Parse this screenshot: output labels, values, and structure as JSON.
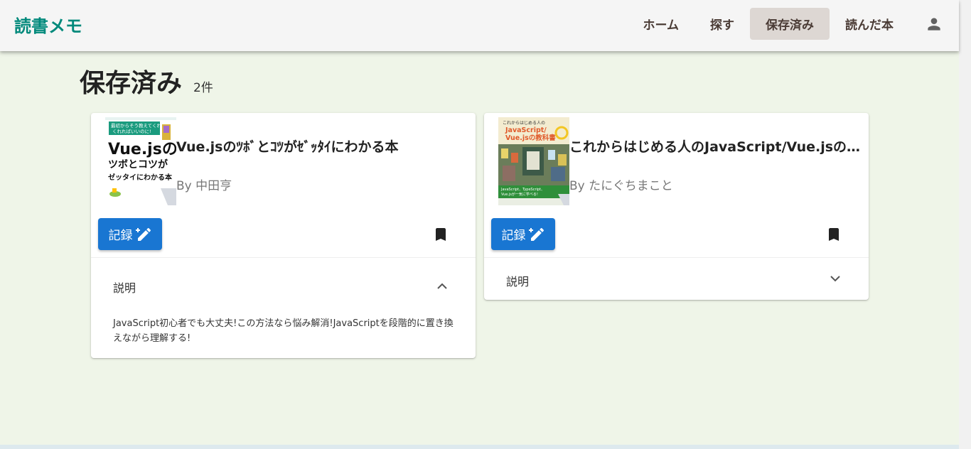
{
  "app": {
    "brand": "読書メモ"
  },
  "nav": {
    "home": "ホーム",
    "search": "探す",
    "saved": "保存済み",
    "read": "読んだ本"
  },
  "page": {
    "title": "保存済み",
    "count": "2件"
  },
  "books": [
    {
      "title": "Vue.jsのﾂﾎﾞとｺﾂがｾﾞｯﾀｲにわかる本",
      "author": "By 中田亨",
      "record_label": "記録",
      "panel_label": "説明",
      "expanded": true,
      "description": "JavaScript初心者でも大丈夫!この方法なら悩み解消!JavaScriptを段階的に置き換えながら理解する!",
      "cover": {
        "banner": "最初からそう教えてくれればいいのに!",
        "line1": "Vue.jsの",
        "line2": "ツボとコツが",
        "line3": "ゼッタイにわかる本"
      }
    },
    {
      "title": "これからはじめる人のJavaScript/Vue.jsの…",
      "author": "By たにぐちまこと",
      "record_label": "記録",
      "panel_label": "説明",
      "expanded": false,
      "cover": {
        "line1": "これからはじめる人の",
        "line2": "JavaScript/",
        "line3": "Vue.jsの教科書"
      }
    }
  ],
  "colors": {
    "brand": "#00897b",
    "primary_button": "#1976d2",
    "background": "#eff5e8",
    "active_nav": "#ddd7d3"
  }
}
